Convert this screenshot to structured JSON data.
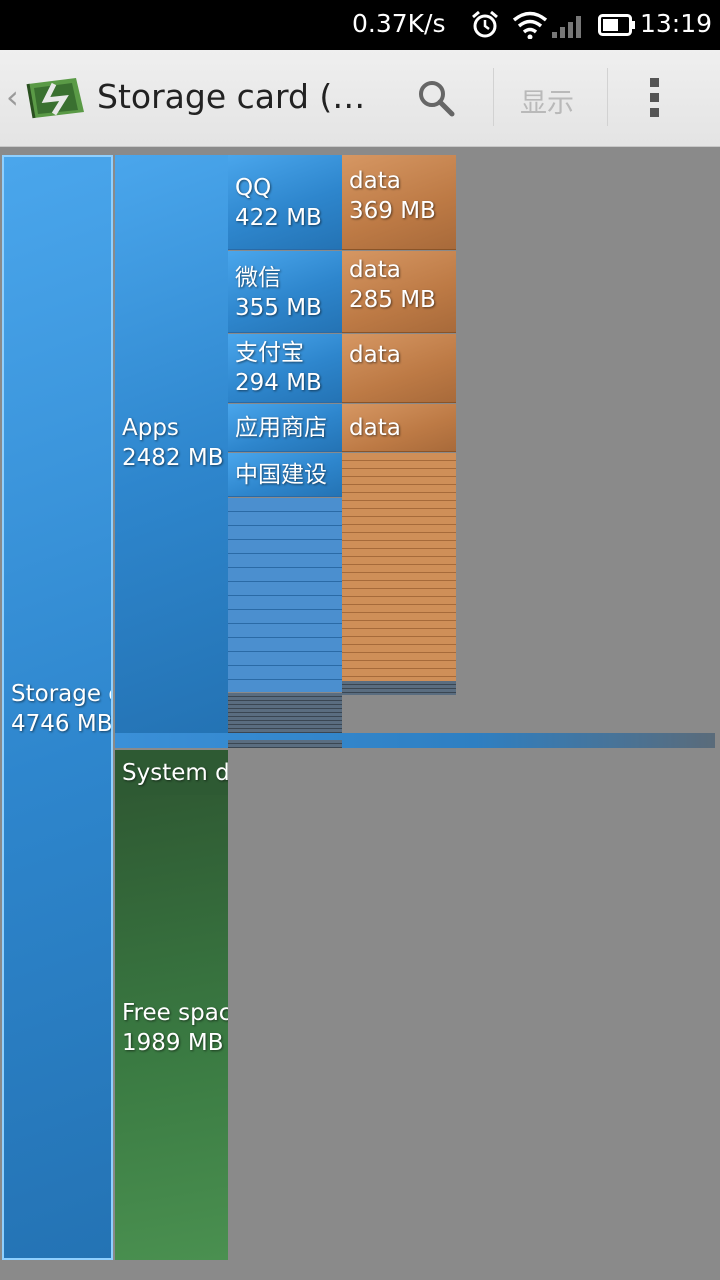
{
  "status_bar": {
    "net_speed": "0.37K/s",
    "time": "13:19",
    "icons": [
      "alarm-icon",
      "wifi-icon",
      "signal-icon",
      "battery-icon"
    ]
  },
  "action_bar": {
    "back_glyph": "‹",
    "title": "Storage card (…",
    "show_label": "显示",
    "icons": [
      "app-logo-icon",
      "search-icon",
      "overflow-menu-icon"
    ]
  },
  "treemap": {
    "root": {
      "name": "Storage c",
      "size": "4746 MB"
    },
    "apps": {
      "name": "Apps",
      "size": "2482 MB"
    },
    "system": {
      "name": "System d"
    },
    "free": {
      "name": "Free spac",
      "size": "1989 MB"
    },
    "app_items": [
      {
        "name": "QQ",
        "size": "422 MB"
      },
      {
        "name": "微信",
        "size": "355 MB"
      },
      {
        "name": "支付宝",
        "size": "294 MB"
      },
      {
        "name": "应用商店",
        "size": ""
      },
      {
        "name": "中国建设",
        "size": ""
      }
    ],
    "data_items": [
      {
        "name": "data",
        "size": "369 MB"
      },
      {
        "name": "data",
        "size": "285 MB"
      },
      {
        "name": "data",
        "size": ""
      },
      {
        "name": "data",
        "size": ""
      }
    ]
  },
  "colors": {
    "apps_blue": "#2e86cd",
    "data_orange": "#bd7a45",
    "free_green": "#3a7a42",
    "background": "#8a8a8a"
  }
}
